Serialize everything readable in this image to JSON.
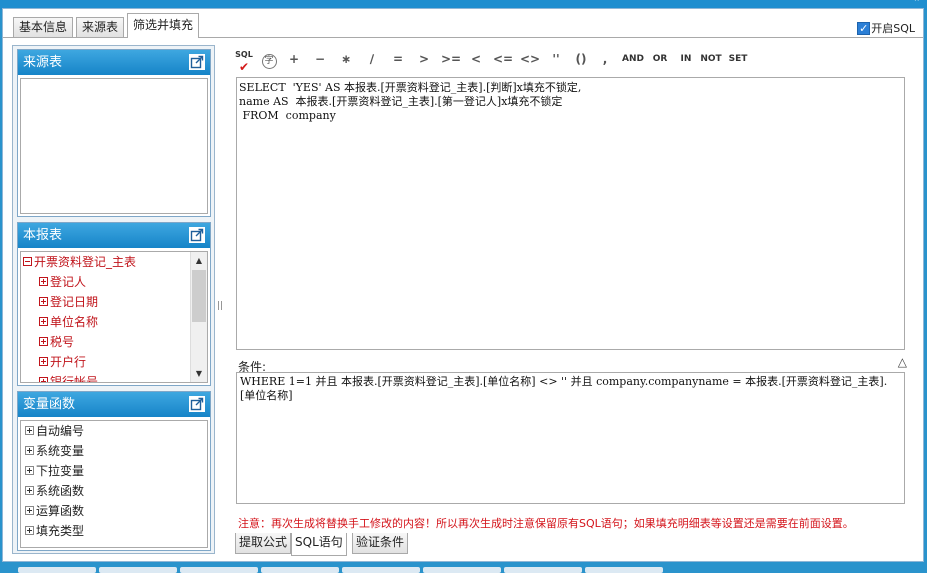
{
  "tabs": [
    {
      "label": "基本信息"
    },
    {
      "label": "来源表"
    },
    {
      "label": "筛选并填充",
      "active": true
    }
  ],
  "sql_toggle": {
    "label": "开启SQL",
    "checked": true
  },
  "source_panel": {
    "title": "来源表"
  },
  "report_panel": {
    "title": "本报表",
    "root": "开票资料登记_主表",
    "items": [
      "登记人",
      "登记日期",
      "单位名称",
      "税号",
      "开户行",
      "银行帐号"
    ]
  },
  "func_panel": {
    "title": "变量函数",
    "items": [
      "自动编号",
      "系统变量",
      "下拉变量",
      "系统函数",
      "运算函数",
      "填充类型"
    ]
  },
  "toolbar": {
    "buttons": [
      "SQL",
      "字",
      "+",
      "−",
      "∗",
      "∕",
      "=",
      ">",
      ">=",
      "<",
      "<=",
      "<>",
      "''",
      "()",
      ",",
      "AND",
      "OR",
      "IN",
      "NOT",
      "SET"
    ]
  },
  "editor": {
    "sql": "SELECT  'YES' AS 本报表.[开票资料登记_主表].[判断]x填充不锁定,\nname AS  本报表.[开票资料登记_主表].[第一登记人]x填充不锁定\n FROM  company"
  },
  "condition": {
    "label": "条件:",
    "text": "WHERE 1=1  并且  本报表.[开票资料登记_主表].[单位名称]  <>  ''  并且 company.companyname  =  本报表.[开票资料登记_主表].[单位名称]"
  },
  "notice": "注意：再次生成将替换手工修改的内容！所以再次生成时注意保留原有SQL语句；如果填充明细表等设置还是需要在前面设置。",
  "bottom_tabs": [
    {
      "label": "提取公式"
    },
    {
      "label": "SQL语句",
      "active": true
    },
    {
      "label": "验证条件"
    }
  ],
  "colors": {
    "accent": "#1f8ecf",
    "panel_head": "#2596d6",
    "tree_red": "#c0141b",
    "notice_red": "#d4141b"
  }
}
